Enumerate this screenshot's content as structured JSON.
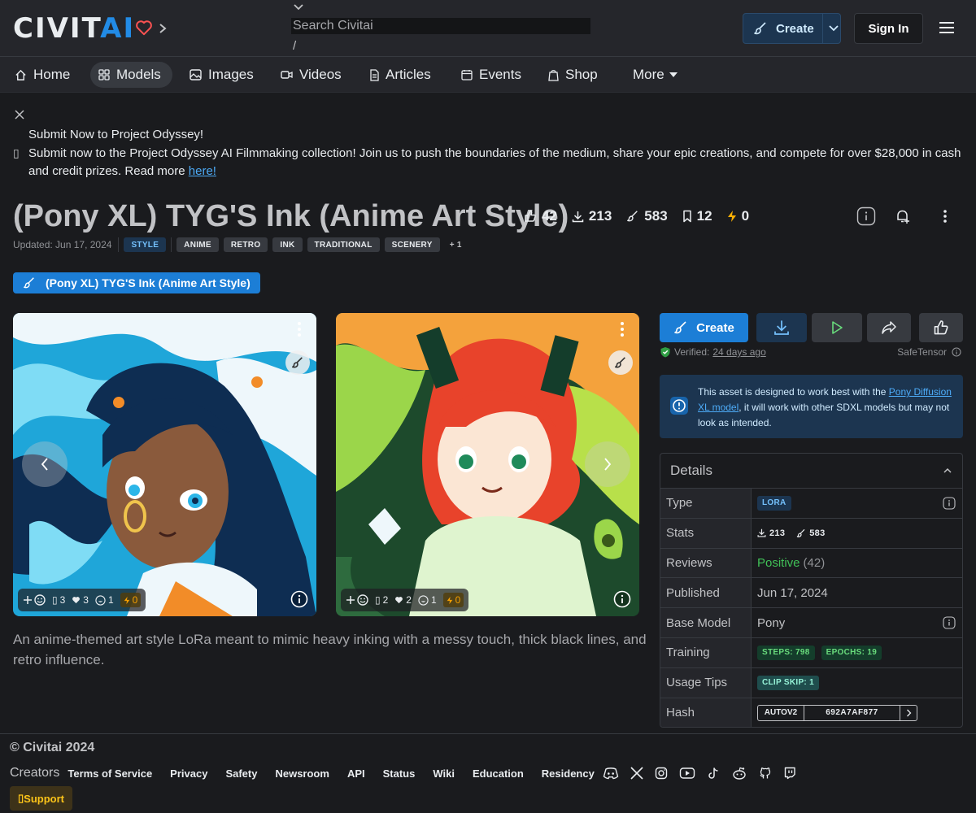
{
  "header": {
    "logo_part1": "CIVIT",
    "logo_part2": "AI",
    "search_placeholder": "Search Civitai",
    "search_shortcut": "/",
    "create_label": "Create",
    "signin_label": "Sign In"
  },
  "nav": {
    "items": [
      {
        "label": "Home",
        "icon": "home-icon"
      },
      {
        "label": "Models",
        "icon": "grid-icon",
        "active": true
      },
      {
        "label": "Images",
        "icon": "image-icon"
      },
      {
        "label": "Videos",
        "icon": "video-icon"
      },
      {
        "label": "Articles",
        "icon": "file-icon"
      },
      {
        "label": "Events",
        "icon": "calendar-icon"
      },
      {
        "label": "Shop",
        "icon": "shopping-bag-icon"
      },
      {
        "label": "More",
        "icon": "caret-down-icon"
      }
    ]
  },
  "banner": {
    "icon_glyph": "▯",
    "title": "Submit Now to Project Odyssey!",
    "text": "Submit now to the Project Odyssey AI Filmmaking collection! Join us to push the boundaries of the medium, share your epic creations, and compete for over $28,000 in cash and credit prizes. Read more ",
    "link": "here!"
  },
  "model": {
    "title": "(Pony XL) TYG'S Ink (Anime Art Style)",
    "stats": {
      "likes": "42",
      "downloads": "213",
      "generations": "583",
      "collected": "12",
      "buzz": "0"
    },
    "updated": "Updated: Jun 17, 2024",
    "category_tag": "STYLE",
    "tags": [
      "ANIME",
      "RETRO",
      "INK",
      "TRADITIONAL",
      "SCENERY"
    ],
    "more_tags": "+ 1",
    "version_label": "(Pony XL) TYG'S Ink (Anime Art Style)",
    "description": "An anime-themed art style LoRa meant to mimic heavy inking with a messy touch, thick black lines, and retro influence."
  },
  "gallery": [
    {
      "comments": "3",
      "hearts": "3",
      "laugh": "1",
      "buzz": "0",
      "glyph": "▯"
    },
    {
      "comments": "2",
      "hearts": "2",
      "laugh": "1",
      "buzz": "0",
      "glyph": "▯"
    }
  ],
  "sidebar": {
    "create_label": "Create",
    "verified_label": "Verified:",
    "verified_time": "24 days ago",
    "file_format": "SafeTensor",
    "alert_pre": "This asset is designed to work best with the ",
    "alert_link": "Pony Diffusion XL model",
    "alert_post": ", it will work with other SDXL models but may not look as intended.",
    "details_title": "Details",
    "details": {
      "type_label": "Type",
      "type_value": "LORA",
      "stats_label": "Stats",
      "stats_downloads": "213",
      "stats_generations": "583",
      "reviews_label": "Reviews",
      "reviews_value": "Positive",
      "reviews_count": "(42)",
      "published_label": "Published",
      "published_value": "Jun 17, 2024",
      "base_label": "Base Model",
      "base_value": "Pony",
      "training_label": "Training",
      "training_steps": "STEPS: 798",
      "training_epochs": "EPOCHS: 19",
      "usage_label": "Usage Tips",
      "usage_value": "CLIP SKIP: 1",
      "hash_label": "Hash",
      "hash_type": "AUTOV2",
      "hash_value": "692A7AF877"
    }
  },
  "footer": {
    "copyright": "© Civitai 2024",
    "links": [
      "Creators",
      "Terms of Service",
      "Privacy",
      "Safety",
      "Newsroom",
      "API",
      "Status",
      "Wiki",
      "Education",
      "Residency"
    ],
    "support_label": "Support",
    "support_glyph": "▯"
  }
}
